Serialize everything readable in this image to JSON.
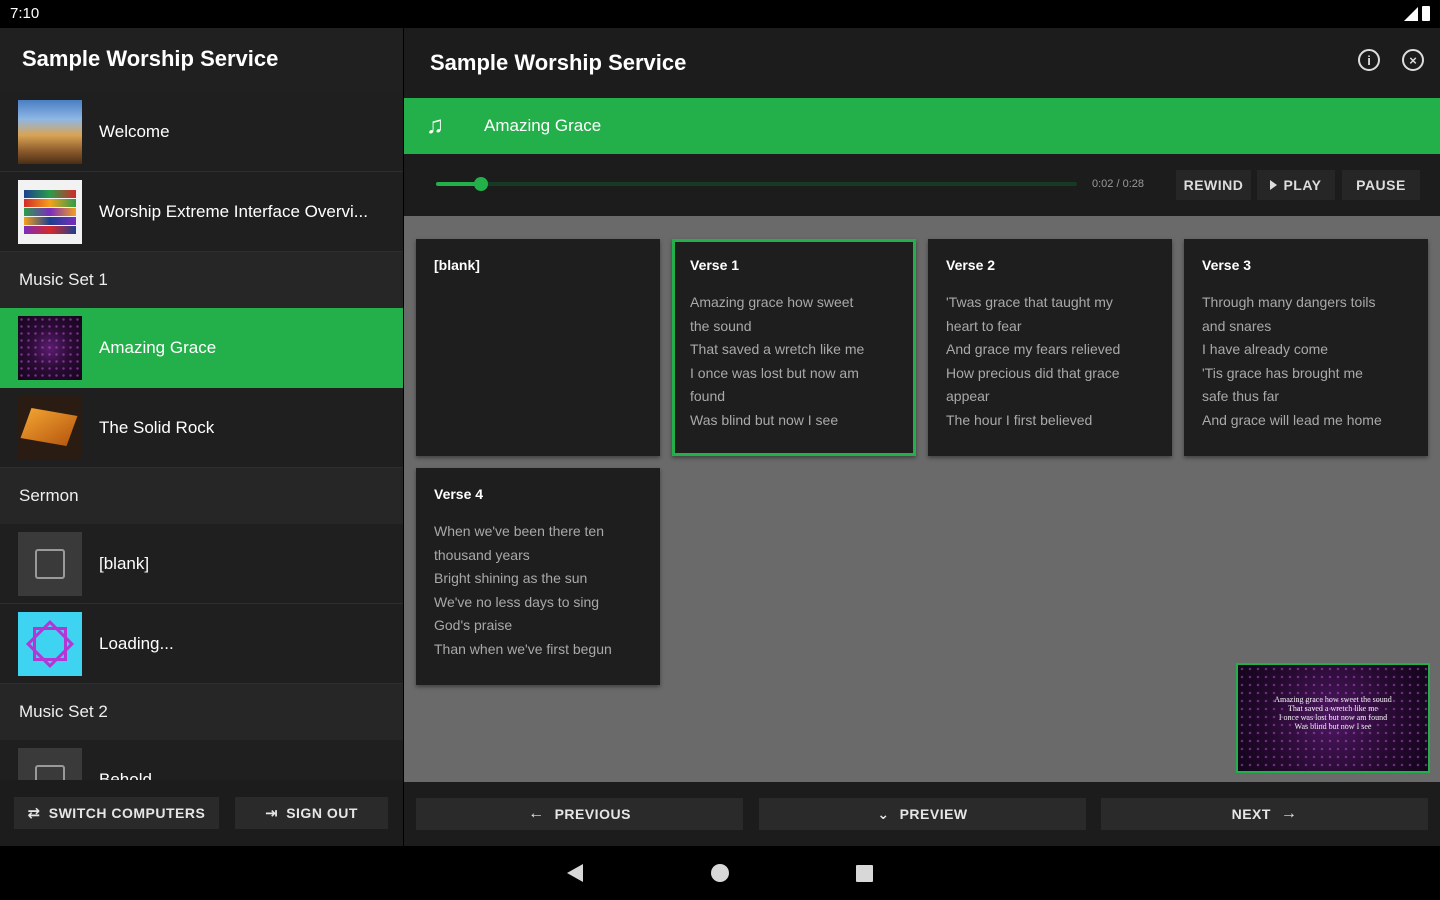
{
  "status_bar": {
    "time": "7:10"
  },
  "left_panel": {
    "title": "Sample Worship Service",
    "items": [
      {
        "type": "item",
        "label": "Welcome",
        "thumb": "landscape"
      },
      {
        "type": "item",
        "label": "Worship Extreme Interface Overvi...",
        "thumb": "overview"
      },
      {
        "type": "section",
        "label": "Music Set 1"
      },
      {
        "type": "item",
        "label": "Amazing Grace",
        "thumb": "purple-pattern",
        "active": true
      },
      {
        "type": "item",
        "label": "The Solid Rock",
        "thumb": "rock"
      },
      {
        "type": "section",
        "label": "Sermon"
      },
      {
        "type": "item",
        "label": "[blank]",
        "thumb": "blank"
      },
      {
        "type": "item",
        "label": "Loading...",
        "thumb": "cyan-star"
      },
      {
        "type": "section",
        "label": "Music Set 2"
      },
      {
        "type": "item",
        "label": "Behold",
        "thumb": "blank"
      }
    ],
    "footer": {
      "switch_label": "SWITCH COMPUTERS",
      "switch_icon": "swap-icon",
      "signout_label": "SIGN OUT",
      "signout_icon": "logout-icon"
    }
  },
  "main": {
    "title": "Sample Worship Service",
    "header_icons": [
      "info-icon",
      "close-circle-icon"
    ],
    "song_title": "Amazing Grace",
    "song_icon": "music-note-icon",
    "player": {
      "progress": 0.07,
      "time": "0:02 / 0:28",
      "rewind_label": "REWIND",
      "play_label": "PLAY",
      "pause_label": "PAUSE"
    },
    "slides": [
      {
        "title": "[blank]",
        "lines": []
      },
      {
        "title": "Verse 1",
        "selected": true,
        "lines": [
          "Amazing grace how sweet",
          "the sound",
          "That saved a wretch like me",
          "I once was lost but now am",
          "found",
          "Was blind but now I see"
        ]
      },
      {
        "title": "Verse 2",
        "lines": [
          "'Twas grace that taught my",
          "heart to fear",
          "And grace my fears relieved",
          "How precious did that grace",
          "appear",
          "The hour I first believed"
        ]
      },
      {
        "title": "Verse 3",
        "lines": [
          "Through many dangers toils",
          "and snares",
          "I have already come",
          "'Tis grace has brought me",
          "safe thus far",
          "And grace will lead me home"
        ]
      },
      {
        "title": "Verse 4",
        "lines": [
          "When we've been there ten",
          "thousand years",
          "Bright shining as the sun",
          "We've no less days to sing",
          "God's praise",
          "Than when we've first begun"
        ]
      }
    ],
    "preview_lines": [
      "Amazing grace how sweet the sound",
      "That saved a wretch like me",
      "I once was lost but now am found",
      "Was blind but now I see"
    ],
    "footer": {
      "previous_label": "PREVIOUS",
      "preview_label": "PREVIEW",
      "next_label": "NEXT"
    }
  },
  "colors": {
    "accent": "#23b04a",
    "panel": "#1c1c1c",
    "canvas": "#6a6a6a"
  }
}
